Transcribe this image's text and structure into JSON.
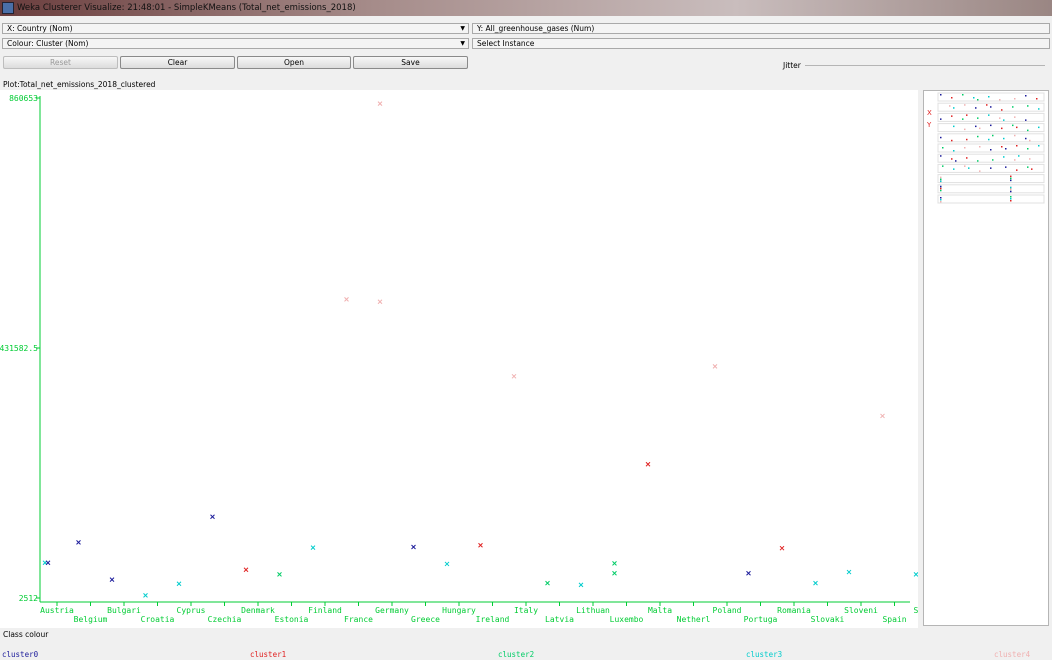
{
  "window": {
    "title": "Weka Clusterer Visualize: 21:48:01 - SimpleKMeans (Total_net_emissions_2018)"
  },
  "controls": {
    "x_axis": "X: Country (Nom)",
    "y_axis": "Y: All_greenhouse_gases (Num)",
    "colour": "Colour: Cluster (Nom)",
    "select_instance": "Select Instance",
    "reset": "Reset",
    "clear": "Clear",
    "open": "Open",
    "save": "Save",
    "jitter_label": "Jitter"
  },
  "plot_label": "Plot:Total_net_emissions_2018_clustered",
  "class_colour_title": "Class colour",
  "colors": {
    "cluster0": "#1a1a9a",
    "cluster1": "#e02020",
    "cluster2": "#00cc66",
    "cluster3": "#00cccc",
    "cluster4": "#f0b0b0",
    "axis": "#00cc33"
  },
  "legend": [
    {
      "name": "cluster0",
      "color": "#1a1a9a"
    },
    {
      "name": "cluster1",
      "color": "#e02020"
    },
    {
      "name": "cluster2",
      "color": "#00cc66"
    },
    {
      "name": "cluster3",
      "color": "#00cccc"
    },
    {
      "name": "cluster4",
      "color": "#f0b0b0"
    }
  ],
  "chart_data": {
    "type": "scatter",
    "title": "",
    "xlabel": "Country",
    "ylabel": "All_greenhouse_gases",
    "y_ticks": [
      "860653",
      "431582.5",
      "2512"
    ],
    "ylim": [
      2512,
      860653
    ],
    "categories": [
      "Austria",
      "Belgium",
      "Bulgari",
      "Croatia",
      "Cyprus",
      "Czechia",
      "Denmark",
      "Estonia",
      "Finland",
      "France",
      "Germany",
      "Greece",
      "Hungary",
      "Ireland",
      "Italy",
      "Latvia",
      "Lithuan",
      "Luxembo",
      "Malta",
      "Netherl",
      "Poland",
      "Portuga",
      "Romania",
      "Slovaki",
      "Sloveni",
      "Spain",
      "Sweden"
    ],
    "points": [
      {
        "x": "Austria",
        "y": 63000,
        "cluster": 3
      },
      {
        "x": "Austria",
        "y": 63000,
        "cluster": 0
      },
      {
        "x": "Belgium",
        "y": 98000,
        "cluster": 0
      },
      {
        "x": "Bulgari",
        "y": 34000,
        "cluster": 0
      },
      {
        "x": "Croatia",
        "y": 7000,
        "cluster": 3
      },
      {
        "x": "Cyprus",
        "y": 27000,
        "cluster": 3
      },
      {
        "x": "Czechia",
        "y": 142000,
        "cluster": 0
      },
      {
        "x": "Denmark",
        "y": 51000,
        "cluster": 1
      },
      {
        "x": "Estonia",
        "y": 43000,
        "cluster": 2
      },
      {
        "x": "Finland",
        "y": 89000,
        "cluster": 3
      },
      {
        "x": "France",
        "y": 515000,
        "cluster": 4
      },
      {
        "x": "Germany",
        "y": 851000,
        "cluster": 4
      },
      {
        "x": "Germany",
        "y": 511000,
        "cluster": 4
      },
      {
        "x": "Greece",
        "y": 90000,
        "cluster": 0
      },
      {
        "x": "Hungary",
        "y": 61000,
        "cluster": 3
      },
      {
        "x": "Ireland",
        "y": 93000,
        "cluster": 1
      },
      {
        "x": "Italy",
        "y": 383000,
        "cluster": 4
      },
      {
        "x": "Latvia",
        "y": 28000,
        "cluster": 2
      },
      {
        "x": "Lithuan",
        "y": 25000,
        "cluster": 3
      },
      {
        "x": "Luxembo",
        "y": 62000,
        "cluster": 2
      },
      {
        "x": "Luxembo",
        "y": 45000,
        "cluster": 2
      },
      {
        "x": "Malta",
        "y": 232000,
        "cluster": 1
      },
      {
        "x": "Poland",
        "y": 400000,
        "cluster": 4
      },
      {
        "x": "Portuga",
        "y": 45000,
        "cluster": 0
      },
      {
        "x": "Romania",
        "y": 88000,
        "cluster": 1
      },
      {
        "x": "Slovaki",
        "y": 28000,
        "cluster": 3
      },
      {
        "x": "Sloveni",
        "y": 47000,
        "cluster": 3
      },
      {
        "x": "Spain",
        "y": 315000,
        "cluster": 4
      },
      {
        "x": "Sweden",
        "y": 43000,
        "cluster": 3
      }
    ]
  }
}
